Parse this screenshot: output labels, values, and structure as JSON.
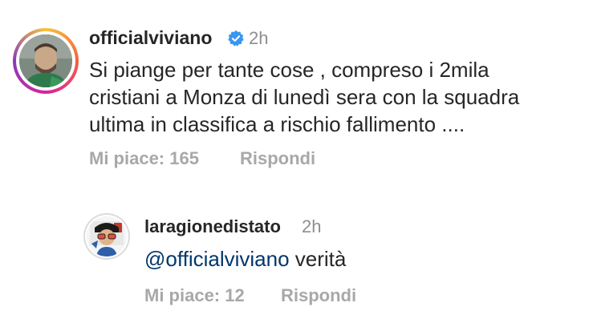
{
  "comment": {
    "username": "officialviviano",
    "verified_icon": "verified-badge-icon",
    "time": "2h",
    "text_lines": [
      "Si piange per tante cose , compreso i 2mila",
      "cristiani a Monza di lunedì sera con la squadra",
      "ultima in classifica a rischio fallimento ...."
    ],
    "likes_label": "Mi piace: 165",
    "reply_label": "Rispondi"
  },
  "reply": {
    "username": "laragionedistato",
    "time": "2h",
    "mention": "@officialviviano",
    "text": " verità",
    "likes_label": "Mi piace: 12",
    "reply_label": "Rispondi"
  },
  "colors": {
    "verified": "#3897f0",
    "mention": "#00376b",
    "muted": "#a8a8a8"
  }
}
